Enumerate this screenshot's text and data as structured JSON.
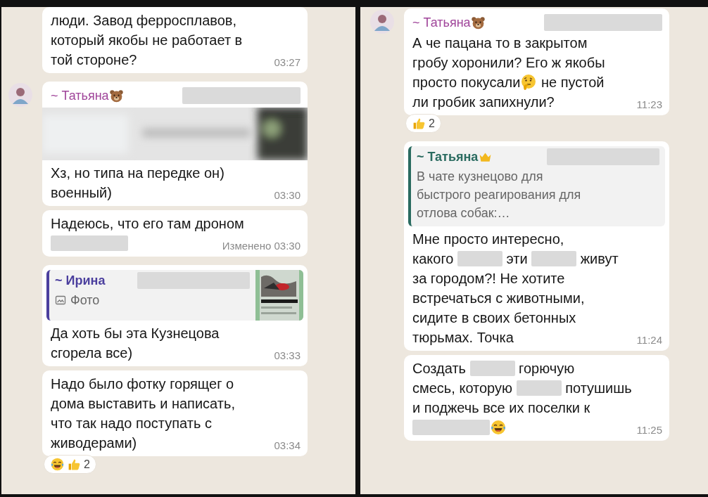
{
  "panels": [
    {
      "messages": [
        {
          "lines": [
            [
              {
                "kind": "text",
                "text": "люди. Завод ферросплавов,"
              }
            ],
            [
              {
                "kind": "text",
                "text": "который якобы не работает в"
              }
            ],
            [
              {
                "kind": "text",
                "text": "той стороне?"
              }
            ]
          ],
          "time": "03:27"
        },
        {
          "sender": {
            "name": "~ Татьяна",
            "badge": {
              "kind": "bear"
            },
            "color": "#a0459a",
            "number_hidden": true
          },
          "preview": {
            "kind": "picture"
          },
          "lines": [
            [
              {
                "kind": "text",
                "text": "Хз, но типа на передке он)"
              }
            ],
            [
              {
                "kind": "text",
                "text": "военный)"
              }
            ]
          ],
          "time": "03:30"
        },
        {
          "lines": [
            [
              {
                "kind": "text",
                "text": "Надеюсь, что его там дроном"
              }
            ],
            [
              {
                "kind": "redacted"
              }
            ]
          ],
          "time": "Изменено 03:30"
        },
        {
          "quote": {
            "name": "~ Ирина",
            "color": "#4b3f9e",
            "number_hidden": true,
            "media": "Фото",
            "thumbnail": {
              "kind": "picture"
            }
          },
          "lines": [
            [
              {
                "kind": "text",
                "text": "Да хоть бы эта Кузнецова"
              }
            ],
            [
              {
                "kind": "text",
                "text": "сгорела все)"
              }
            ]
          ],
          "time": "03:33"
        },
        {
          "lines": [
            [
              {
                "kind": "text",
                "text": "Надо было фотку горящег о"
              }
            ],
            [
              {
                "kind": "text",
                "text": "дома выставить и написать,"
              }
            ],
            [
              {
                "kind": "text",
                "text": "что так надо поступать с"
              }
            ],
            [
              {
                "kind": "text",
                "text": "живодерами)"
              }
            ]
          ],
          "time": "03:34",
          "reactions": {
            "items": [
              {
                "kind": "laughing"
              },
              {
                "kind": "thumbs"
              }
            ],
            "count": "2"
          }
        }
      ]
    },
    {
      "messages": [
        {
          "sender": {
            "name": "~ Татьяна",
            "badge": {
              "kind": "bear"
            },
            "color": "#a0459a",
            "number_hidden": true
          },
          "lines": [
            [
              {
                "kind": "text",
                "text": "А че пацана то в закрытом"
              }
            ],
            [
              {
                "kind": "text",
                "text": "гробу хоронили? Его ж якобы"
              }
            ],
            [
              {
                "kind": "text",
                "text": "просто покусали"
              },
              {
                "kind": "thinking"
              },
              {
                "kind": "text",
                "text": " не пустой"
              }
            ],
            [
              {
                "kind": "text",
                "text": "ли гробик запихнули?"
              }
            ]
          ],
          "time": "11:23",
          "reactions": {
            "items": [
              {
                "kind": "thumbs"
              }
            ],
            "count": "2"
          }
        },
        {
          "quote": {
            "name": "~ Татьяна",
            "badge": {
              "kind": "crown"
            },
            "color": "#2a6b60",
            "number_hidden": true,
            "lines": [
              "В чате кузнецово для",
              "быстрого реагирования для",
              "отлова собак:…"
            ]
          },
          "lines": [
            [
              {
                "kind": "text",
                "text": "Мне просто интересно,"
              }
            ],
            [
              {
                "kind": "text",
                "text": "какого "
              },
              {
                "kind": "redacted"
              },
              {
                "kind": "text",
                "text": " эти "
              },
              {
                "kind": "redacted"
              },
              {
                "kind": "text",
                "text": " живут"
              }
            ],
            [
              {
                "kind": "text",
                "text": "за городом?! Не хотите"
              }
            ],
            [
              {
                "kind": "text",
                "text": "встречаться с животными,"
              }
            ],
            [
              {
                "kind": "text",
                "text": "сидите в своих бетонных"
              }
            ],
            [
              {
                "kind": "text",
                "text": "тюрьмах. Точка"
              }
            ]
          ],
          "time": "11:24"
        },
        {
          "lines": [
            [
              {
                "kind": "text",
                "text": "Создать "
              },
              {
                "kind": "redacted"
              },
              {
                "kind": "text",
                "text": " горючую"
              }
            ],
            [
              {
                "kind": "text",
                "text": "смесь, которую "
              },
              {
                "kind": "redacted"
              },
              {
                "kind": "text",
                "text": " потушишь"
              }
            ],
            [
              {
                "kind": "text",
                "text": "и поджечь все их поселки к"
              }
            ],
            [
              {
                "kind": "redacted"
              },
              {
                "kind": "laughing"
              }
            ]
          ],
          "time": "11:25"
        }
      ]
    }
  ]
}
